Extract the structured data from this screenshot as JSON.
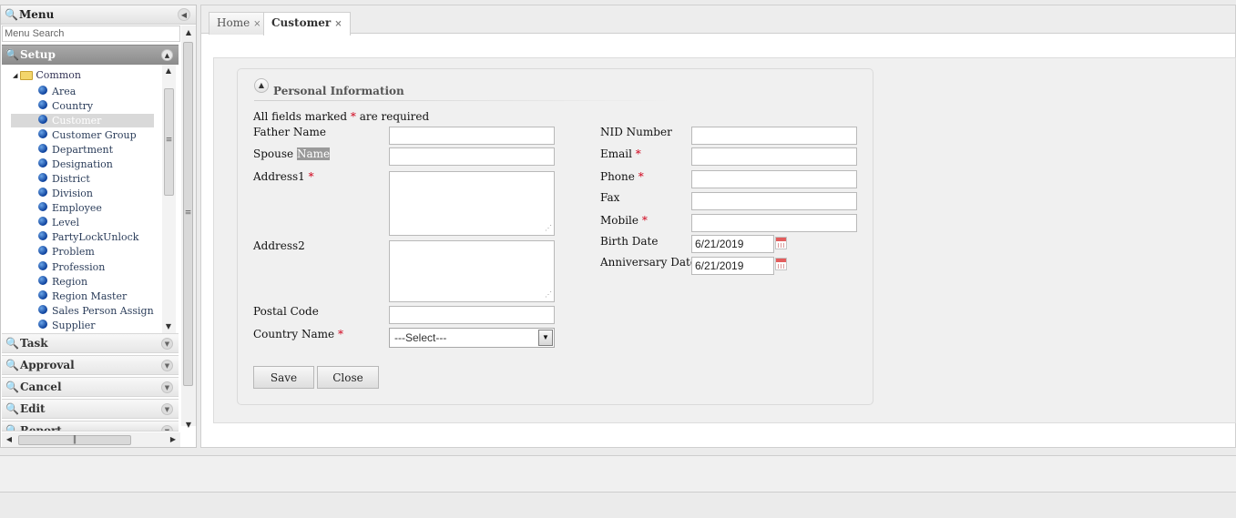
{
  "menu": {
    "title": "Menu",
    "search_placeholder": "Menu Search",
    "sections": [
      {
        "label": "Setup"
      },
      {
        "label": "Task"
      },
      {
        "label": "Approval"
      },
      {
        "label": "Cancel"
      },
      {
        "label": "Edit"
      },
      {
        "label": "Report"
      }
    ],
    "tree": {
      "root": "Common",
      "items": [
        {
          "label": "Area"
        },
        {
          "label": "Country"
        },
        {
          "label": "Customer"
        },
        {
          "label": "Customer Group"
        },
        {
          "label": "Department"
        },
        {
          "label": "Designation"
        },
        {
          "label": "District"
        },
        {
          "label": "Division"
        },
        {
          "label": "Employee"
        },
        {
          "label": "Level"
        },
        {
          "label": "PartyLockUnlock"
        },
        {
          "label": "Problem"
        },
        {
          "label": "Profession"
        },
        {
          "label": "Region"
        },
        {
          "label": "Region Master"
        },
        {
          "label": "Sales Person Assign"
        },
        {
          "label": "Supplier"
        }
      ]
    }
  },
  "tabs": [
    {
      "label": "Home",
      "close": "×"
    },
    {
      "label": "Customer",
      "close": "×"
    }
  ],
  "form": {
    "section_title": "Personal Information",
    "required_note_prefix": "All fields marked",
    "required_note_suffix": "are required",
    "required_marker": "*",
    "father_name_label": "Father Name",
    "spouse_label_a": "Spouse",
    "spouse_label_b": "Name",
    "address1_label": "Address1",
    "address2_label": "Address2",
    "postal_code_label": "Postal Code",
    "country_name_label": "Country Name",
    "country_select_value": "---Select---",
    "nid_label": "NID Number",
    "email_label": "Email",
    "phone_label": "Phone",
    "fax_label": "Fax",
    "mobile_label": "Mobile",
    "birth_date_label": "Birth Date",
    "birth_date_value": "6/21/2019",
    "anniversary_label": "Anniversary Date",
    "anniversary_value": "6/21/2019",
    "save_label": "Save",
    "close_label": "Close"
  },
  "icons": {
    "search": "magnifier-icon",
    "collapse": "chevron-left-icon",
    "calendar": "calendar-icon"
  },
  "colors": {
    "required": "#d0021b",
    "active_accordion": "#999999",
    "tree_dot": "#0b3f9b"
  }
}
